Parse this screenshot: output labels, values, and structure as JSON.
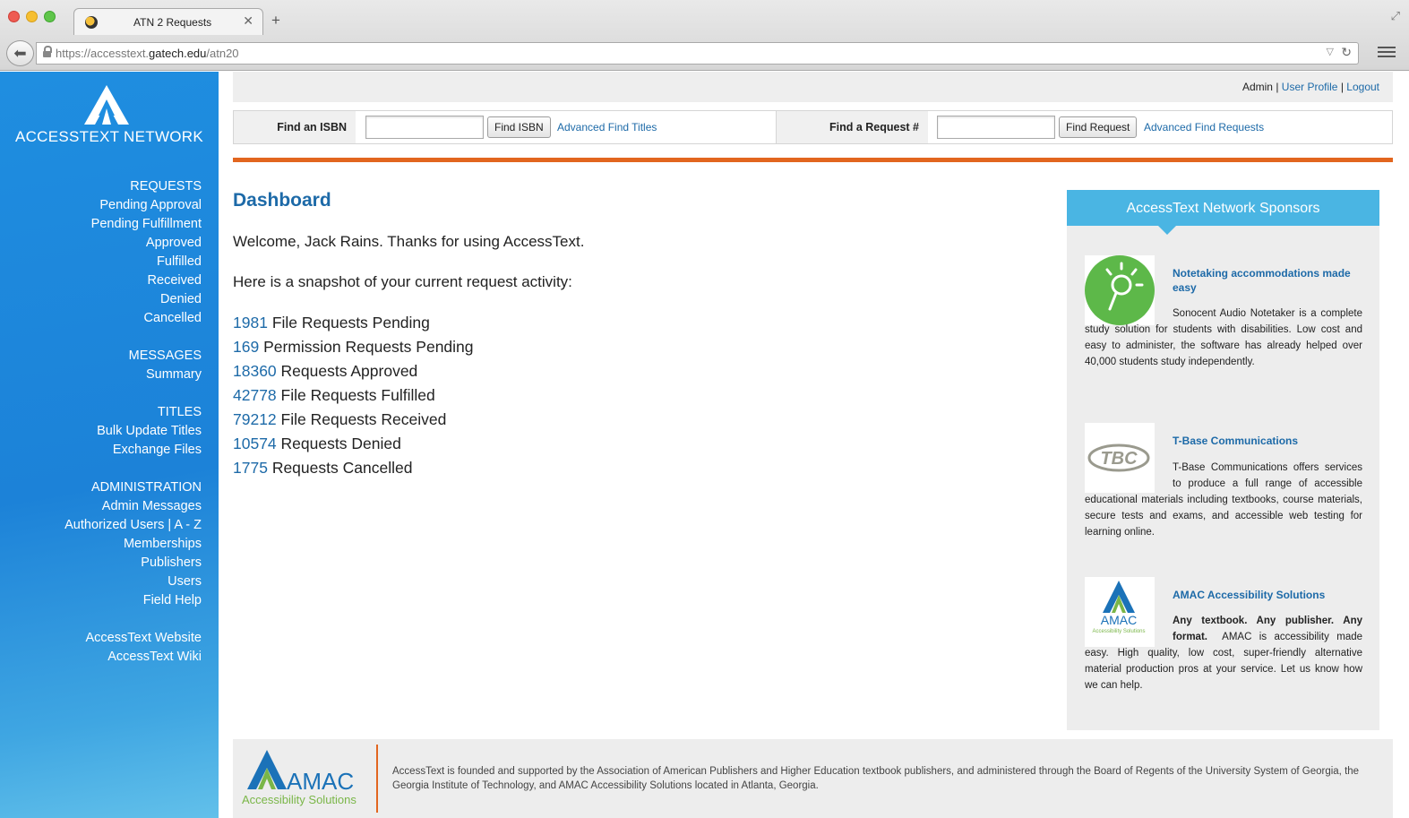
{
  "browser": {
    "tab_title": "ATN 2 Requests",
    "url_prefix": "https://accesstext.",
    "url_host": "gatech.edu",
    "url_path": "/atn20"
  },
  "brand": {
    "logo_text": "ACCESSTEXT NETWORK",
    "primary_color": "#1f8ee0",
    "accent_color": "#e2661f",
    "link_color": "#1d6aa8"
  },
  "nav": {
    "requests": {
      "heading": "REQUESTS",
      "items": [
        "Pending Approval",
        "Pending Fulfillment",
        "Approved",
        "Fulfilled",
        "Received",
        "Denied",
        "Cancelled"
      ]
    },
    "messages": {
      "heading": "MESSAGES",
      "items": [
        "Summary"
      ]
    },
    "titles": {
      "heading": "TITLES",
      "items": [
        "Bulk Update Titles",
        "Exchange Files"
      ]
    },
    "administration": {
      "heading": "ADMINISTRATION",
      "items": [
        "Admin Messages",
        "Authorized Users | A - Z",
        "Memberships",
        "Publishers",
        "Users",
        "Field Help"
      ]
    },
    "external": {
      "items": [
        "AccessText Website",
        "AccessText Wiki"
      ]
    }
  },
  "toplinks": {
    "admin": "Admin",
    "separator": "|",
    "user_profile": "User Profile",
    "logout": "Logout"
  },
  "find": {
    "isbn_label": "Find an ISBN",
    "isbn_value": "",
    "isbn_button": "Find ISBN",
    "isbn_advanced": "Advanced Find Titles",
    "request_label": "Find a Request #",
    "request_value": "",
    "request_button": "Find Request",
    "request_advanced": "Advanced Find Requests"
  },
  "dashboard": {
    "title": "Dashboard",
    "welcome": "Welcome, Jack Rains. Thanks for using AccessText.",
    "snapshot": "Here is a snapshot of your current request activity:",
    "stats": [
      {
        "count": "1981",
        "label": "File Requests Pending"
      },
      {
        "count": "169",
        "label": "Permission Requests Pending"
      },
      {
        "count": "18360",
        "label": "Requests Approved"
      },
      {
        "count": "42778",
        "label": "File Requests Fulfilled"
      },
      {
        "count": "79212",
        "label": "File Requests Received"
      },
      {
        "count": "10574",
        "label": "Requests Denied"
      },
      {
        "count": "1775",
        "label": "Requests Cancelled"
      }
    ]
  },
  "sponsors": {
    "heading": "AccessText Network Sponsors",
    "items": [
      {
        "logo": "microphone-bulb-icon",
        "title": "Notetaking accommodations made easy",
        "lead": "",
        "description": "Sonocent Audio Notetaker is a complete study solution for students with disabilities. Low cost and easy to administer, the software has already helped over 40,000 students study independently."
      },
      {
        "logo": "tbc-logo",
        "logo_text": "TBC",
        "title": "T-Base Communications",
        "lead": "",
        "description": "T-Base Communications offers services to produce a full range of accessible educational materials including textbooks, course materials, secure tests and exams, and accessible web testing for learning online."
      },
      {
        "logo": "amac-logo",
        "logo_text": "AMAC",
        "logo_subtext": "Accessibility Solutions",
        "title": "AMAC Accessibility Solutions",
        "lead": "Any textbook. Any publisher. Any format.",
        "description": "AMAC is accessibility made easy. High quality, low cost, super-friendly alternative material production pros at your service. Let us know how we can help."
      }
    ]
  },
  "footer": {
    "logo_text": "AMAC",
    "logo_subtext": "Accessibility Solutions",
    "text": "AccessText is founded and supported by the Association of American Publishers and Higher Education textbook publishers, and administered through the Board of Regents of the University System of Georgia, the Georgia Institute of Technology, and AMAC Accessibility Solutions located in Atlanta, Georgia."
  }
}
